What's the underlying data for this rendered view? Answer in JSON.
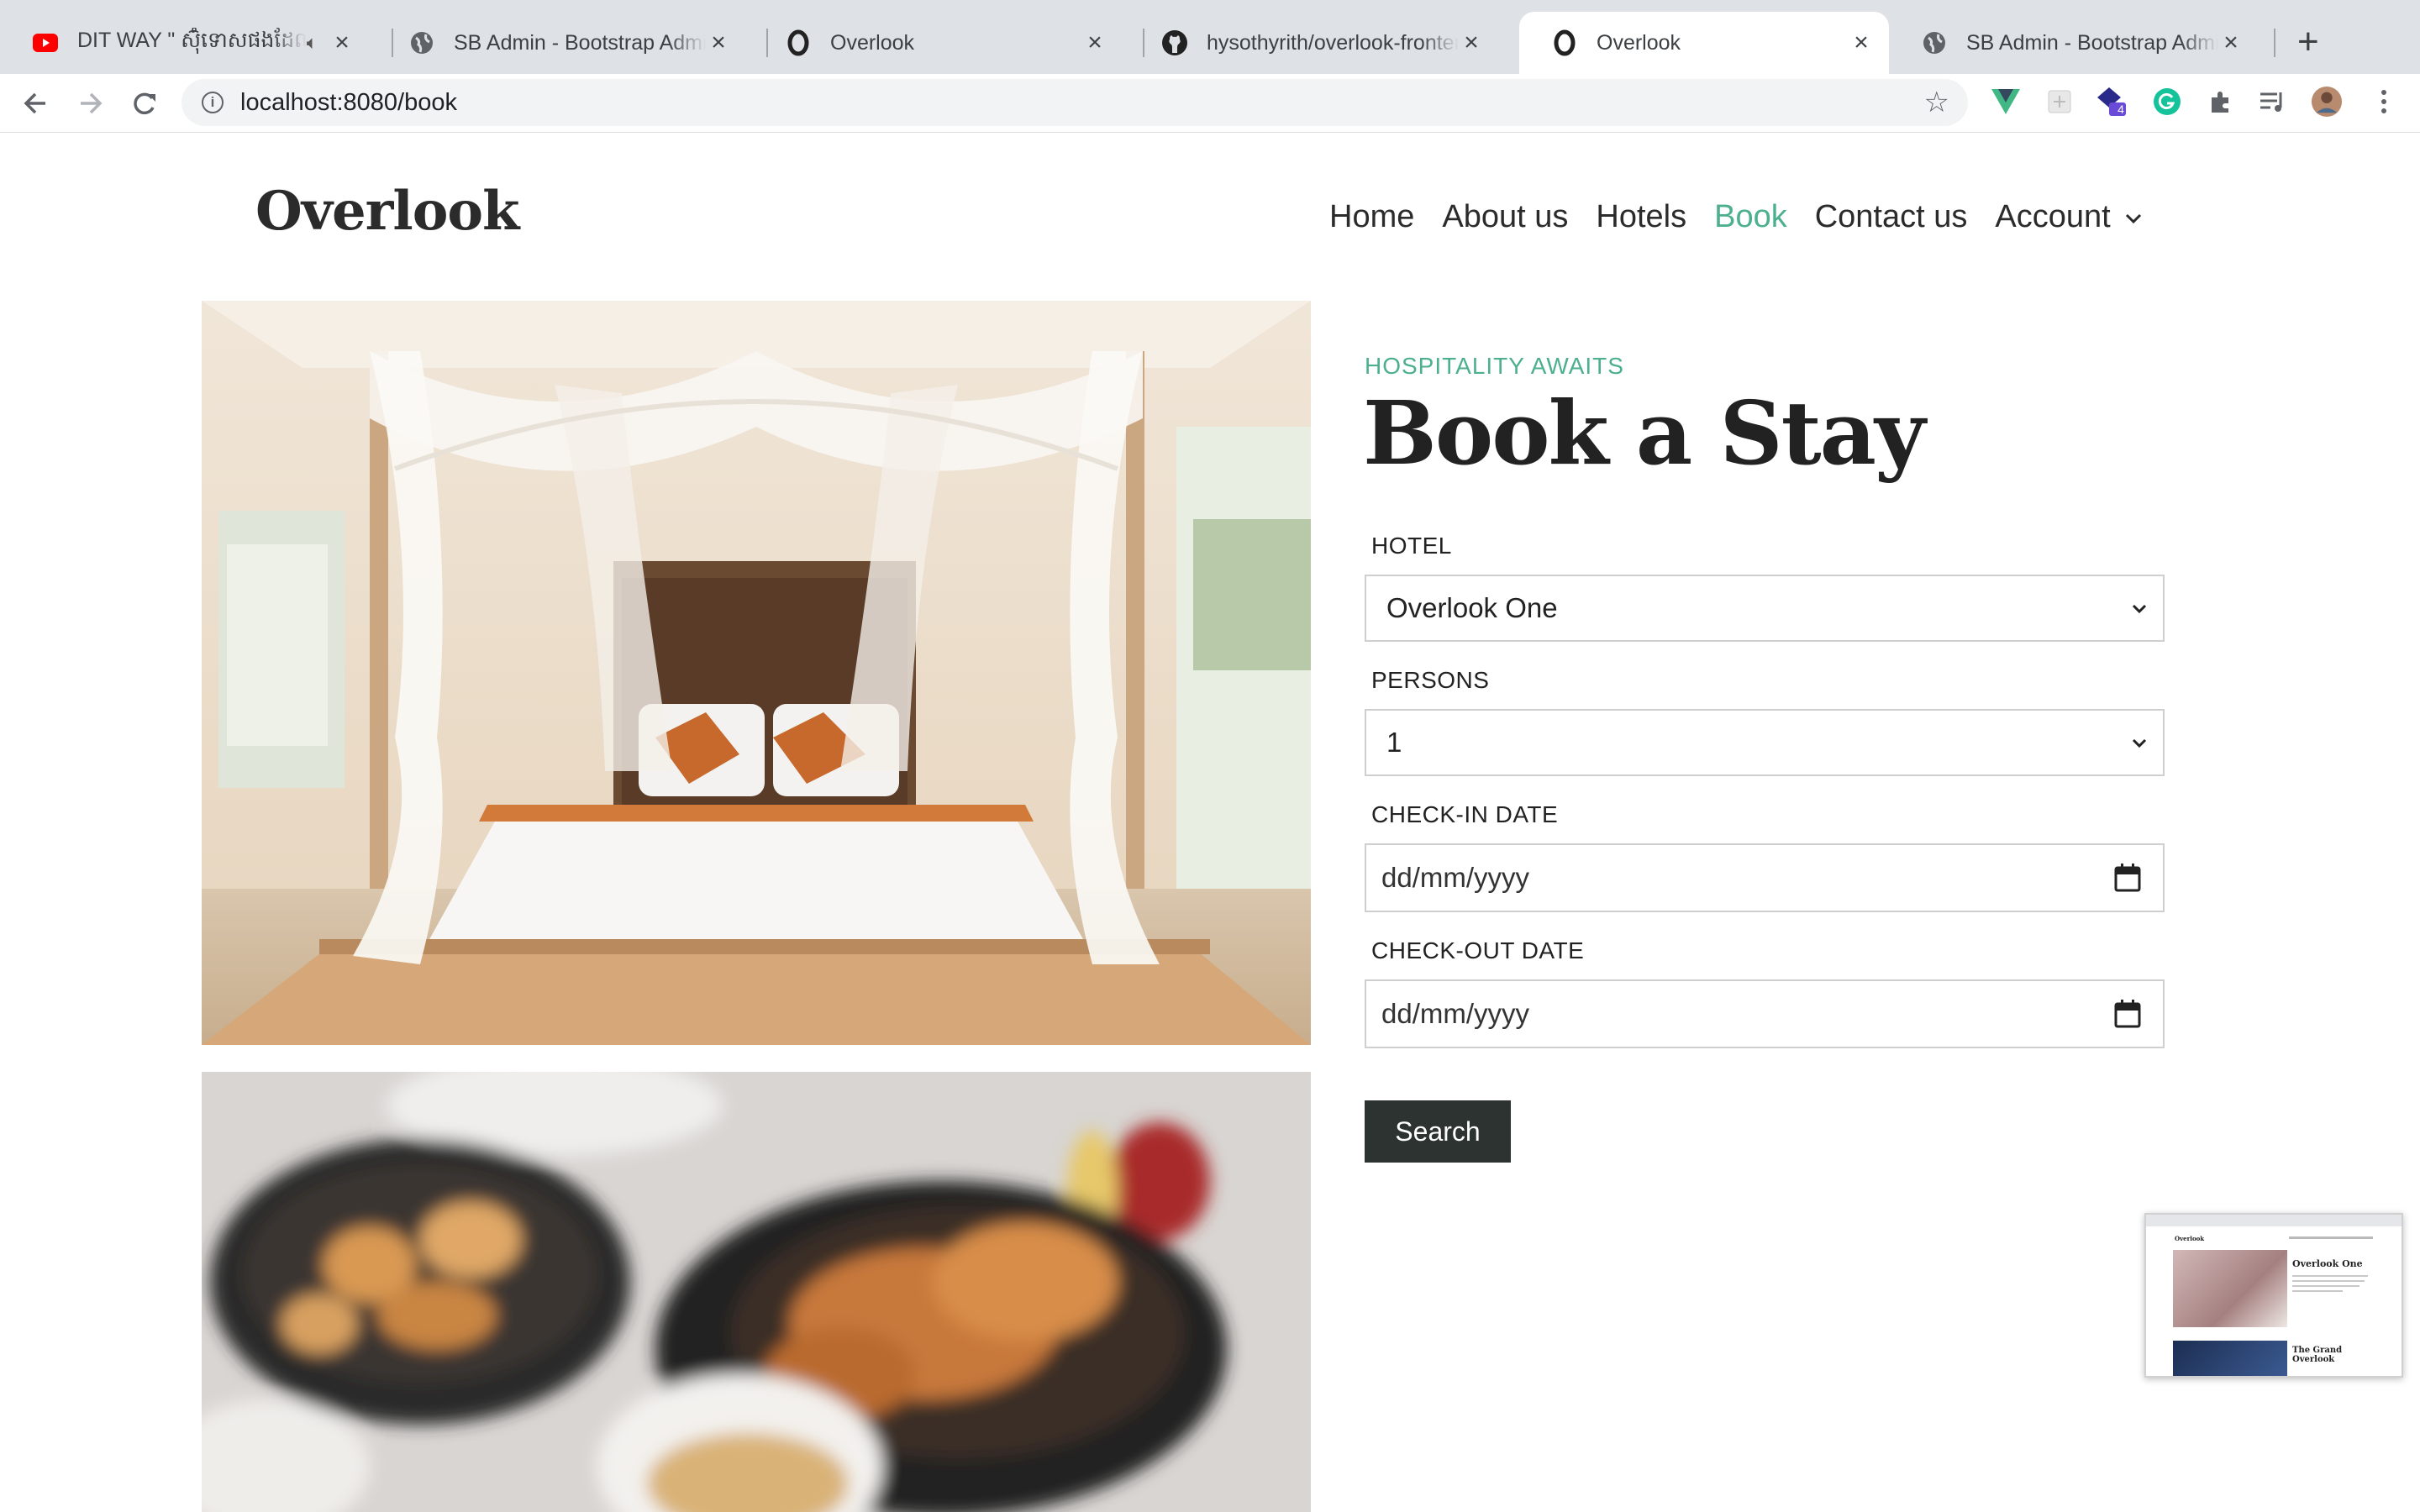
{
  "browser": {
    "tabs": [
      {
        "title": "DIT WAY \" ស៊ុំទោសផងដែល",
        "favicon": "youtube-icon",
        "audio": true,
        "active": false
      },
      {
        "title": "SB Admin - Bootstrap Admin",
        "favicon": "globe-icon",
        "active": false
      },
      {
        "title": "Overlook",
        "favicon": "overlook-o-icon",
        "active": false
      },
      {
        "title": "hysothyrith/overlook-frontend",
        "favicon": "github-icon",
        "active": false
      },
      {
        "title": "Overlook",
        "favicon": "overlook-o-icon",
        "active": true
      },
      {
        "title": "SB Admin - Bootstrap Admin",
        "favicon": "globe-icon",
        "active": false
      }
    ],
    "url": "localhost:8080/book",
    "extension_badge": "4"
  },
  "site": {
    "brand": "Overlook",
    "nav": [
      {
        "label": "Home",
        "active": false
      },
      {
        "label": "About us",
        "active": false
      },
      {
        "label": "Hotels",
        "active": false
      },
      {
        "label": "Book",
        "active": true
      },
      {
        "label": "Contact us",
        "active": false
      },
      {
        "label": "Account",
        "active": false,
        "dropdown": true
      }
    ],
    "accent_color": "#4caf8e",
    "button_color": "#2c3331"
  },
  "booking": {
    "eyebrow": "HOSPITALITY AWAITS",
    "title": "Book a Stay",
    "hotel_label": "HOTEL",
    "hotel_value": "Overlook One",
    "persons_label": "PERSONS",
    "persons_value": "1",
    "checkin_label": "CHECK-IN DATE",
    "checkin_placeholder": "dd/mm/yyyy",
    "checkout_label": "CHECK-OUT DATE",
    "checkout_placeholder": "dd/mm/yyyy",
    "search_label": "Search"
  },
  "preview": {
    "brand": "Overlook",
    "title1": "Overlook One",
    "title2": "The Grand Overlook"
  }
}
